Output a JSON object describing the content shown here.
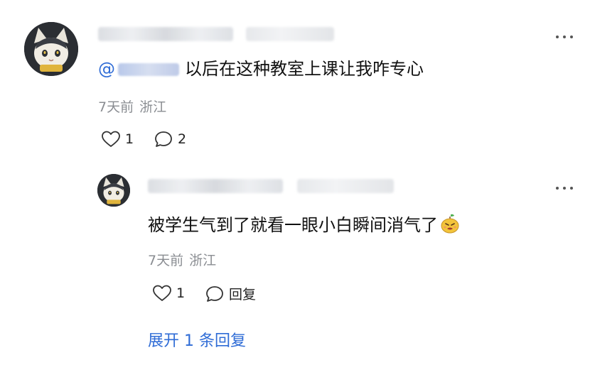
{
  "comment": {
    "content_prefix": "@",
    "content_text": "以后在这种教室上课让我咋专心",
    "time": "7天前",
    "location": "浙江",
    "like_count": "1",
    "reply_count": "2"
  },
  "reply": {
    "content_text": "被学生气到了就看一眼小白瞬间消气了",
    "emoji": "pear-face-emoji",
    "time": "7天前",
    "location": "浙江",
    "like_count": "1",
    "reply_label": "回复"
  },
  "expand": {
    "label": "展开 1 条回复"
  },
  "colors": {
    "link": "#2f6cd6",
    "meta": "#8a8d92"
  }
}
